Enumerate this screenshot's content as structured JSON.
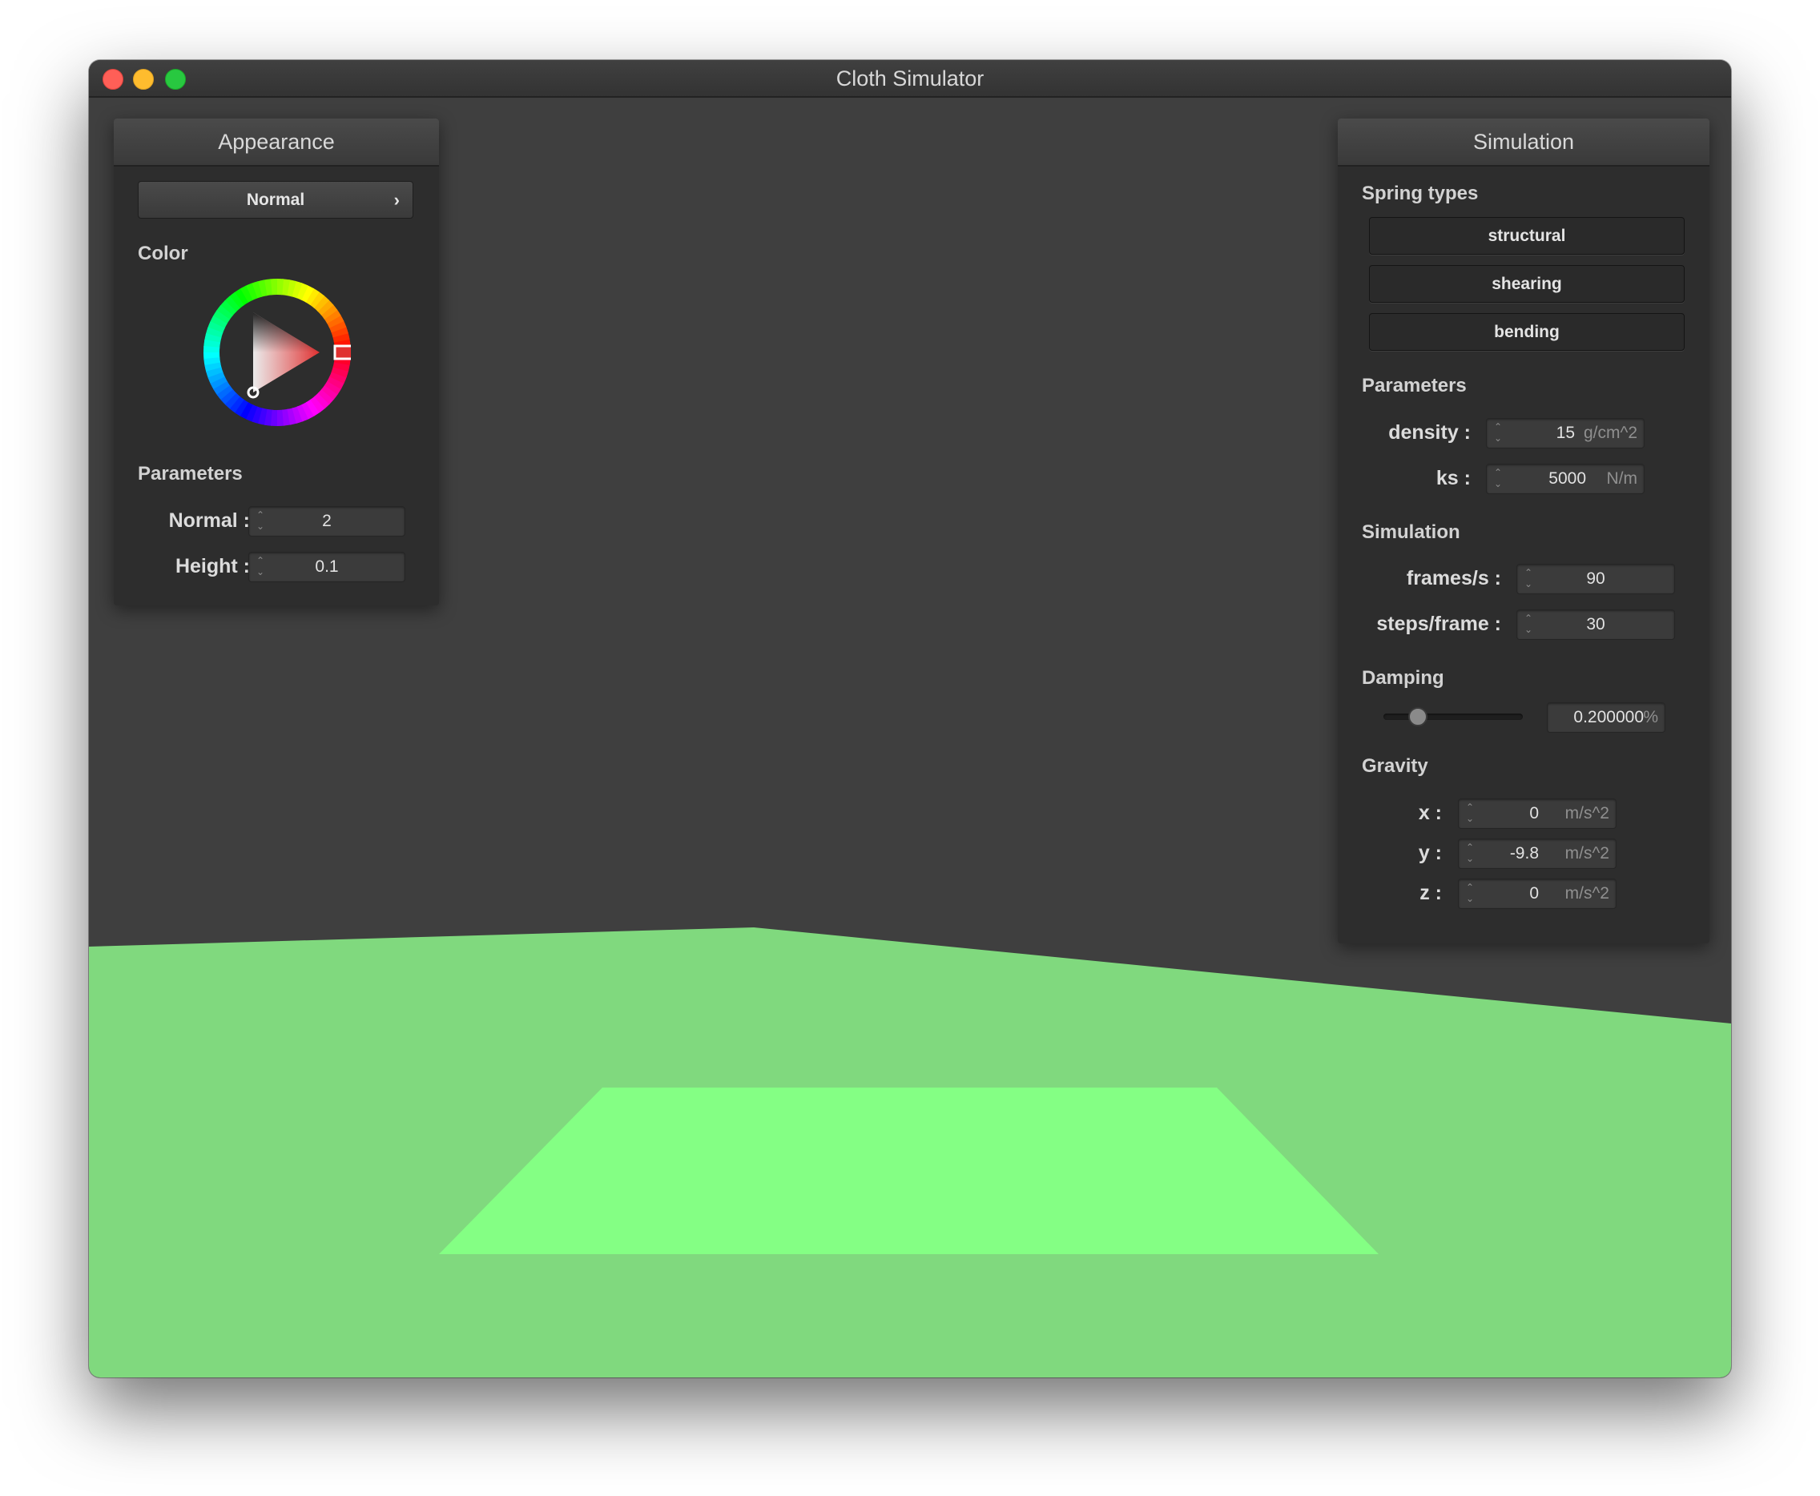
{
  "window": {
    "title": "Cloth Simulator"
  },
  "viewport": {
    "background_color": "#3f3f3f",
    "ground_color": "#80d97e",
    "cloth_color": "#84ff84"
  },
  "appearance": {
    "title": "Appearance",
    "shader_dropdown": {
      "selected": "Normal",
      "chevron": "›"
    },
    "color_label": "Color",
    "color_wheel": {
      "hue": "red",
      "selected_color": "#e03030"
    },
    "parameters_label": "Parameters",
    "normal": {
      "label": "Normal :",
      "value": "2"
    },
    "height": {
      "label": "Height :",
      "value": "0.1"
    }
  },
  "simulation": {
    "title": "Simulation",
    "spring_types_label": "Spring types",
    "spring_types": [
      "structural",
      "shearing",
      "bending"
    ],
    "parameters_label": "Parameters",
    "density": {
      "label": "density :",
      "value": "15",
      "unit": "g/cm^2"
    },
    "ks": {
      "label": "ks :",
      "value": "5000",
      "unit": "N/m"
    },
    "simulation_label": "Simulation",
    "frames_per_s": {
      "label": "frames/s :",
      "value": "90"
    },
    "steps_per_frame": {
      "label": "steps/frame :",
      "value": "30"
    },
    "damping_label": "Damping",
    "damping": {
      "value": "0.200000",
      "unit": "%",
      "slider_fraction": 0.2
    },
    "gravity_label": "Gravity",
    "gravity": {
      "x": {
        "label": "x :",
        "value": "0",
        "unit": "m/s^2"
      },
      "y": {
        "label": "y :",
        "value": "-9.8",
        "unit": "m/s^2"
      },
      "z": {
        "label": "z :",
        "value": "0",
        "unit": "m/s^2"
      }
    }
  }
}
